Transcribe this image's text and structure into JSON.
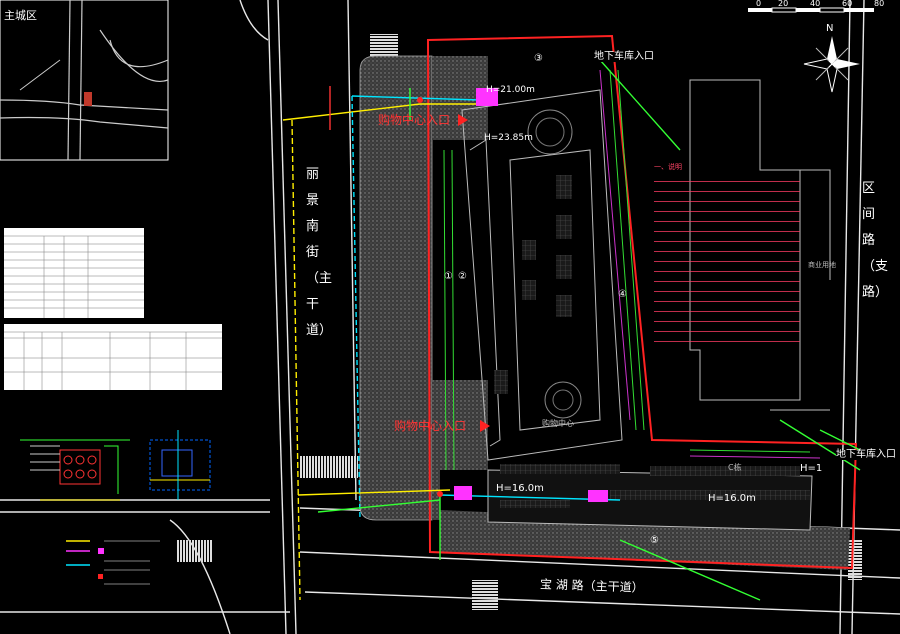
{
  "map": {
    "district": "主城区",
    "south_road": "宝 湖 路（主干道）",
    "west_road_chars": [
      "丽",
      "景",
      "南",
      "街",
      "（",
      "主",
      "干",
      "道",
      "）"
    ],
    "east_road_chars": [
      "区",
      "间",
      "路",
      "（",
      "支",
      "路",
      "）"
    ],
    "mall_entry_north": "购物中心入口",
    "mall_entry_south": "购物中心入口",
    "garage_entry_north": "地下车库入口",
    "garage_entry_south": "地下车库入口",
    "elev_north_a": "H=21.00m",
    "elev_north_b": "H=23.85m",
    "elev_south_a": "H=16.0m",
    "elev_south_b": "H=16.0m",
    "elev_east": "H=1",
    "building_label": "购物中心",
    "hotel_label": "商业用地",
    "section_c": "C栋",
    "circle_1": "①",
    "circle_2": "②",
    "circle_3": "③",
    "circle_4": "④",
    "circle_5": "⑤",
    "compass": "N",
    "scale_ticks": [
      "0",
      "20",
      "40",
      "60",
      "80"
    ]
  },
  "notes": {
    "title": "一、说明"
  },
  "colors": {
    "boundary": "#ff2222",
    "road": "#ffffff",
    "pipe_yellow": "#ffee00",
    "pipe_cyan": "#00e5ff",
    "pipe_green": "#33ff33",
    "magenta": "#ff33ff",
    "plaza": "#555555"
  }
}
